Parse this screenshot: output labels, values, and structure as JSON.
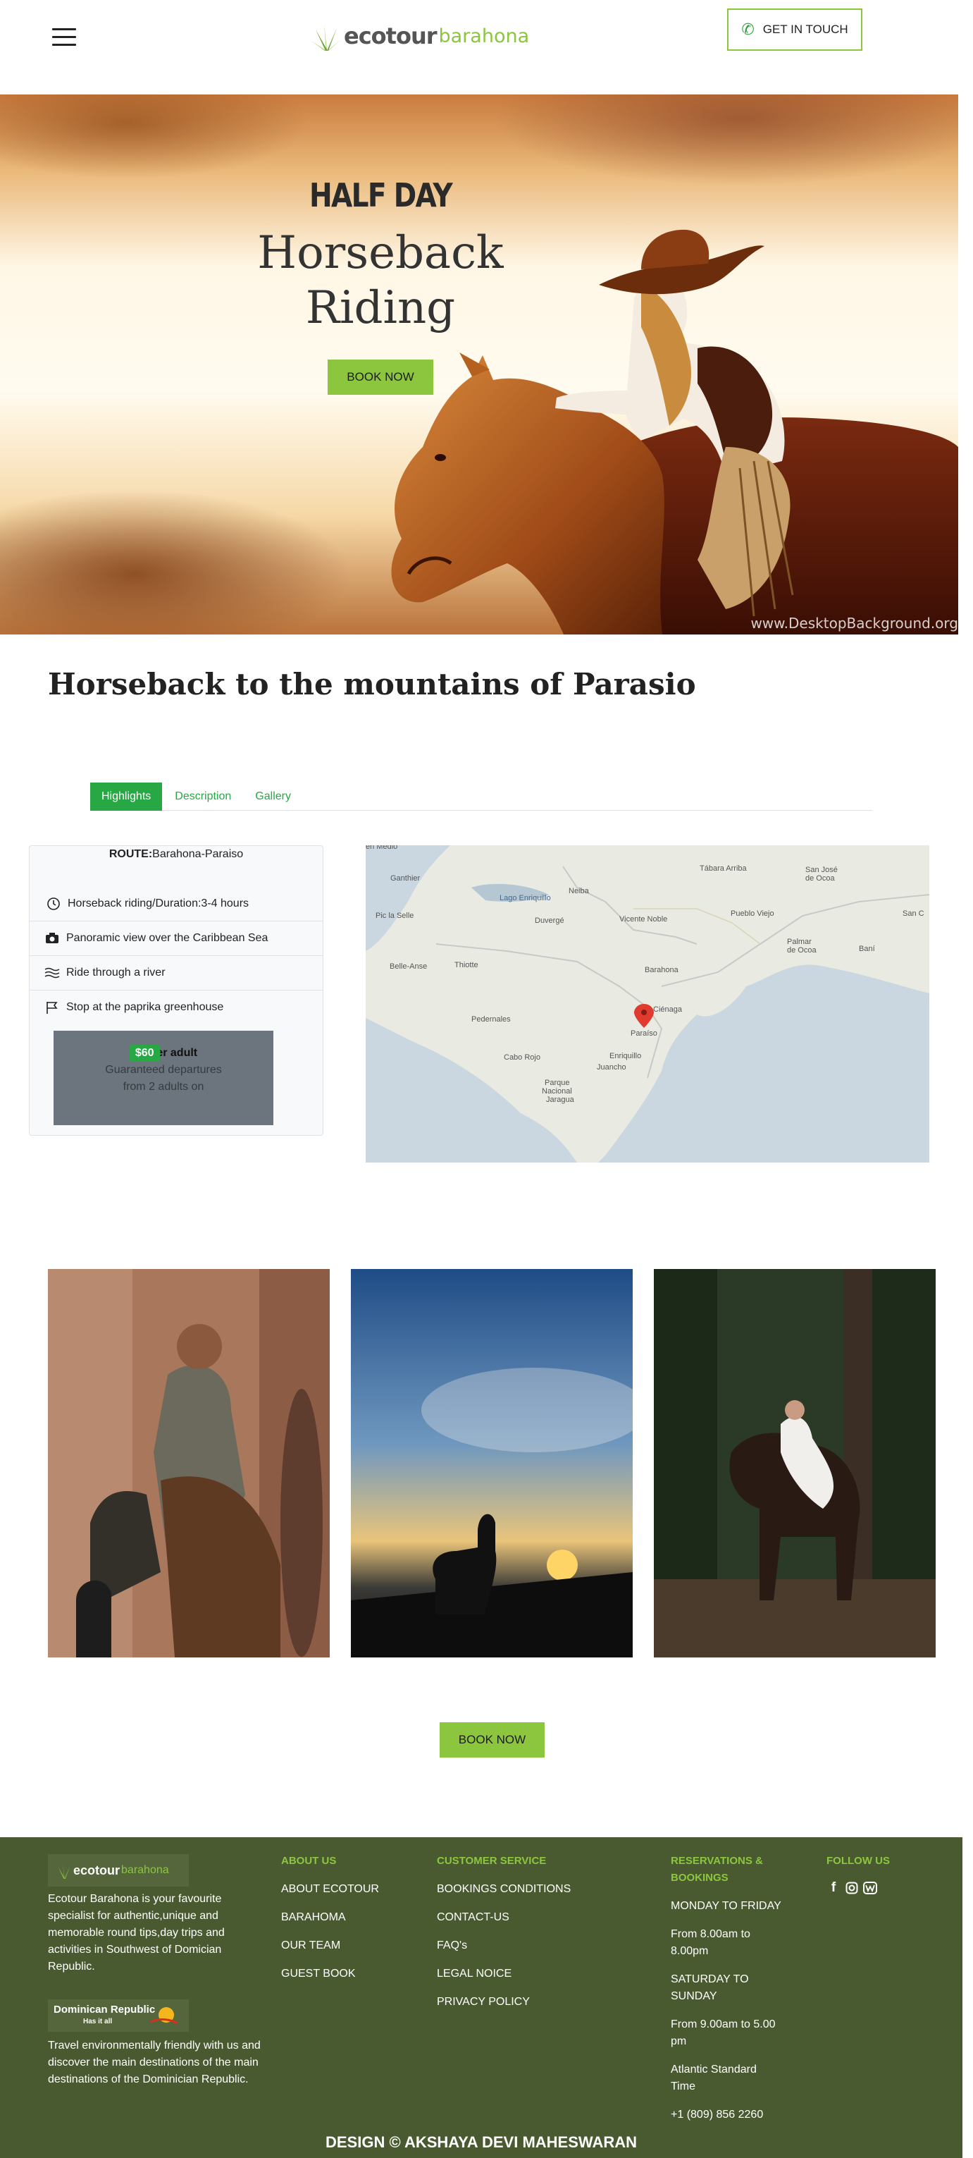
{
  "header": {
    "logo_eco": "ecotour",
    "logo_barahona": "barahona",
    "contact_label": "GET IN TOUCH"
  },
  "hero": {
    "kicker": "HALF DAY",
    "title_line1": "Horseback",
    "title_line2": "Riding",
    "book_label": "BOOK NOW",
    "watermark": "www.DesktopBackground.org"
  },
  "tour": {
    "title": "Horseback to the mountains of Parasio"
  },
  "tabs": [
    {
      "label": "Highlights",
      "active": true
    },
    {
      "label": "Description",
      "active": false
    },
    {
      "label": "Gallery",
      "active": false
    }
  ],
  "info": {
    "route_label": "ROUTE:",
    "route_value": "Barahona-Paraiso",
    "items": [
      {
        "icon": "clock-icon",
        "text": "Horseback riding/Duration:3-4 hours"
      },
      {
        "icon": "camera-icon",
        "text": "Panoramic view over the Caribbean Sea"
      },
      {
        "icon": "water-icon",
        "text": "Ride through a river"
      },
      {
        "icon": "flag-icon",
        "text": "Stop at the paprika greenhouse"
      }
    ],
    "price": "$60",
    "price_unit": "per adult",
    "price_note1": "Guaranteed departures",
    "price_note2": "from 2 adults on"
  },
  "map": {
    "labels": [
      "Ganthier",
      "Pic la Selle",
      "Belle-Anse",
      "Thiotte",
      "Pedernales",
      "Lago Enriquillo",
      "Neiba",
      "Duvergé",
      "Tábara Arriba",
      "San José de Ocoa",
      "Vicente Noble",
      "Pueblo Viejo",
      "Palmar de Ocoa",
      "Baní",
      "San C",
      "Barahona",
      "Ciénaga",
      "Paraíso",
      "Cabo Rojo",
      "Enriquillo",
      "Juancho",
      "Parque Nacional Jaragua"
    ],
    "marker": "map-pin-icon"
  },
  "gallery": {
    "book_label": "BOOK NOW"
  },
  "footer": {
    "logo_eco": "ecotour",
    "logo_barahona": "barahona",
    "about_text": "Ecotour Barahona is your favourite specialist for authentic,unique and memorable round tips,day trips and activities in Southwest of Domician Republic.",
    "badge_title": "Dominican Republic",
    "badge_sub": "Has it all",
    "travel_text": "Travel environmentally friendly with us and discover the main destinations of the main destinations of the Dominician Republic.",
    "about_head": "ABOUT US",
    "about_links": [
      "ABOUT ECOTOUR",
      "BARAHOMA",
      "OUR TEAM",
      "GUEST BOOK"
    ],
    "service_head": "CUSTOMER SERVICE",
    "service_links": [
      "BOOKINGS CONDITIONS",
      "CONTACT-US",
      "FAQ's",
      "LEGAL NOICE",
      "PRIVACY POLICY"
    ],
    "reserve_head1": "RESERVATIONS &",
    "reserve_head2": "BOOKINGS",
    "reserve_lines": [
      "MONDAY TO FRIDAY",
      "From 8.00am to 8.00pm",
      "SATURDAY TO SUNDAY",
      "From 9.00am to 5.00 pm",
      "Atlantic Standard Time",
      "+1 (809) 856 2260"
    ],
    "follow_head": "FOLLOW US",
    "social": [
      "facebook-icon",
      "instagram-icon",
      "website-icon"
    ],
    "copyright": "DESIGN © AKSHAYA DEVI MAHESWARAN"
  },
  "colors": {
    "accent_green": "#8cc63f",
    "tab_green": "#28a745",
    "footer_bg": "#4a5a30"
  }
}
